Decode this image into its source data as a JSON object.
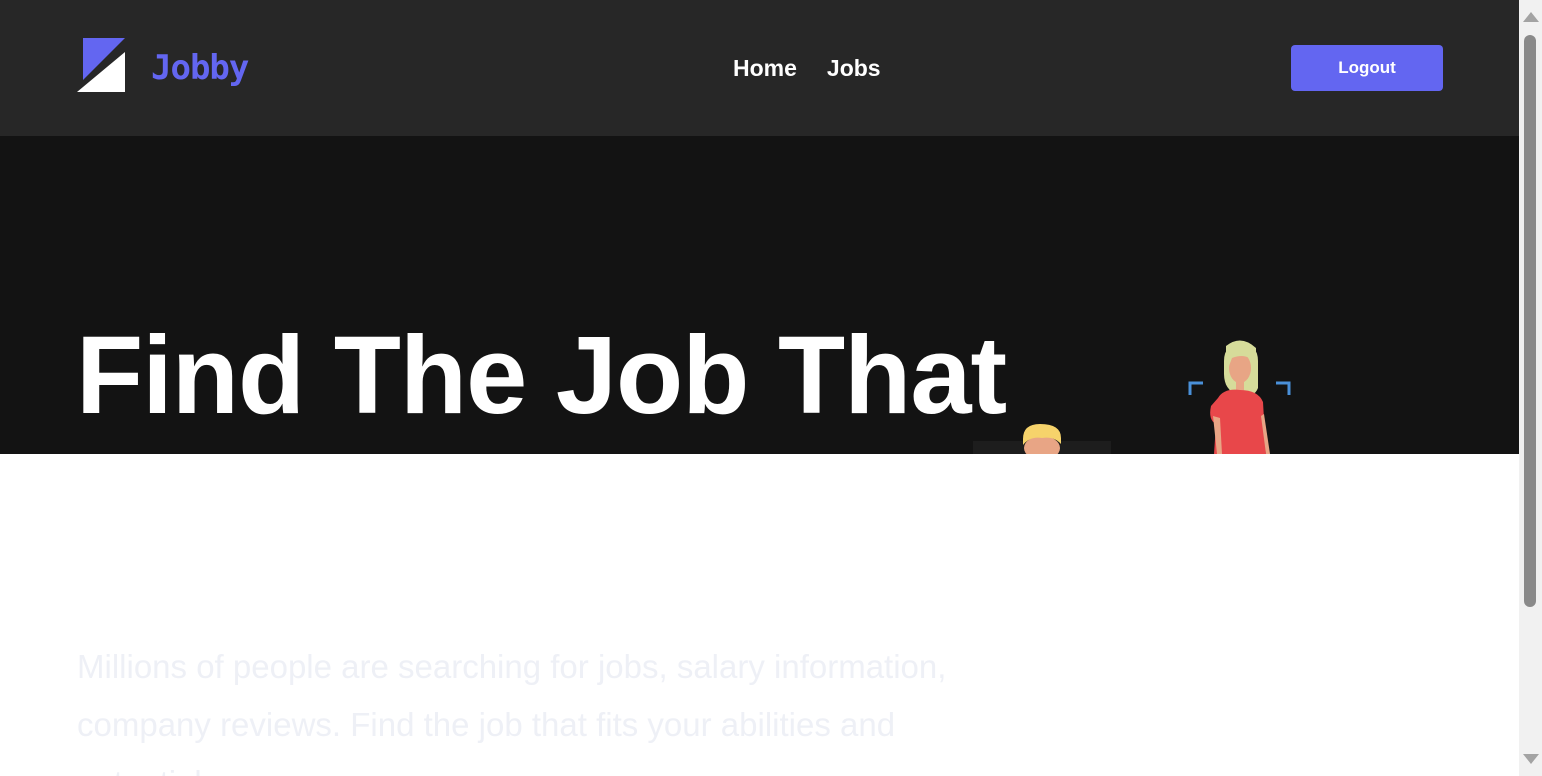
{
  "navbar": {
    "logo_text": "Jobby",
    "links": [
      {
        "label": "Home"
      },
      {
        "label": "Jobs"
      }
    ],
    "logout_label": "Logout"
  },
  "hero": {
    "title": "Find The Job That",
    "description": "Millions of people are searching for jobs, salary information, company reviews. Find the job that fits your abilities and potential."
  },
  "colors": {
    "accent": "#6366f1",
    "navbar_bg": "#272727",
    "hero_bg": "#131313"
  }
}
